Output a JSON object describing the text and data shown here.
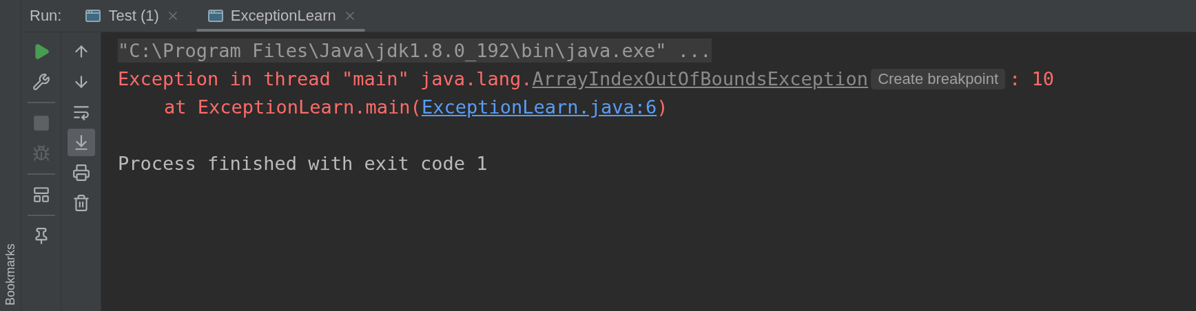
{
  "side_strip": {
    "label": "Bookmarks"
  },
  "run_bar": {
    "label": "Run:",
    "tabs": [
      {
        "label": "Test (1)",
        "selected": false
      },
      {
        "label": "ExceptionLearn",
        "selected": true
      }
    ]
  },
  "toolbar_left": [
    {
      "kind": "run",
      "disabled": false
    },
    {
      "kind": "settings",
      "disabled": false
    },
    {
      "kind": "separator"
    },
    {
      "kind": "stop",
      "disabled": true
    },
    {
      "kind": "debug",
      "disabled": true
    },
    {
      "kind": "separator"
    },
    {
      "kind": "layout",
      "disabled": false
    },
    {
      "kind": "separator"
    },
    {
      "kind": "pin",
      "disabled": false
    }
  ],
  "toolbar_right": [
    {
      "kind": "up",
      "selected": false
    },
    {
      "kind": "down",
      "selected": false
    },
    {
      "kind": "wrap",
      "selected": false
    },
    {
      "kind": "scroll_end",
      "selected": true
    },
    {
      "kind": "print",
      "selected": false
    },
    {
      "kind": "clear",
      "selected": false
    }
  ],
  "console": [
    {
      "indented": false,
      "gap_before": false,
      "segments": [
        {
          "kind": "command",
          "text": "\"C:\\Program Files\\Java\\jdk1.8.0_192\\bin\\java.exe\" ..."
        }
      ]
    },
    {
      "indented": false,
      "gap_before": false,
      "segments": [
        {
          "kind": "error",
          "text": "Exception in thread \"main\" java.lang."
        },
        {
          "kind": "class_link",
          "text": "ArrayIndexOutOfBoundsException"
        },
        {
          "kind": "hint",
          "text": "Create breakpoint"
        },
        {
          "kind": "error",
          "text": ": 10"
        }
      ]
    },
    {
      "indented": true,
      "gap_before": false,
      "segments": [
        {
          "kind": "error",
          "text": "at ExceptionLearn.main("
        },
        {
          "kind": "file_link",
          "text": "ExceptionLearn.java:6"
        },
        {
          "kind": "error",
          "text": ")"
        }
      ]
    },
    {
      "indented": false,
      "gap_before": true,
      "segments": [
        {
          "kind": "normal",
          "text": "Process finished with exit code 1"
        }
      ]
    }
  ]
}
